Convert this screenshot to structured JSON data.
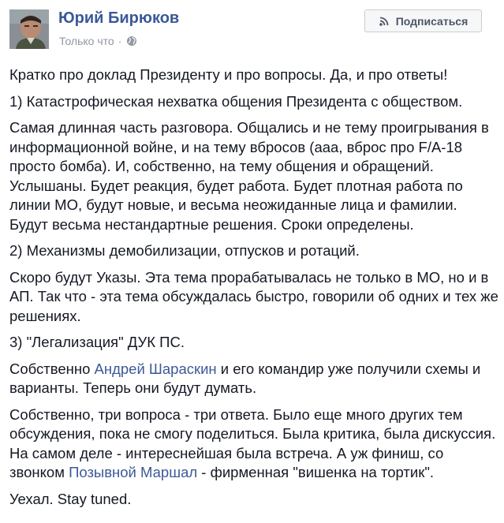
{
  "header": {
    "author": "Юрий Бирюков",
    "time": "Только что",
    "dot": "·",
    "privacy_icon": "globe-icon",
    "subscribe_label": "Подписаться",
    "subscribe_icon": "rss-icon"
  },
  "colors": {
    "link": "#3b5998",
    "text": "#141823",
    "meta": "#9197a3"
  },
  "post": {
    "p1": "Кратко про доклад Президенту и про вопросы. Да, и про ответы!",
    "p2": "1) Катастрофическая нехватка общения Президента с обществом.",
    "p3": "Самая длинная часть разговора. Общались и не тему проигрывания в информационной войне, и на тему вбросов (ааа, вброс про F/A-18 просто бомба). И, собственно, на тему общения и обращений. Услышаны. Будет реакция, будет работа. Будет плотная работа по линии МО, будут новые, и весьма неожиданные лица и фамилии. Будут весьма нестандартные решения. Сроки определены.",
    "p4": "2) Механизмы демобилизации, отпусков и ротаций.",
    "p5": "Скоро будут Указы. Эта тема прорабатывалась не только в МО, но и в АП. Так что - эта тема обсуждалась быстро, говорили об одних и тех же решениях.",
    "p6": "3) \"Легализация\" ДУК ПС.",
    "p7_a": "Собственно ",
    "p7_link": "Андрей Шараскин",
    "p7_b": " и его командир уже получили схемы и варианты. Теперь они будут думать.",
    "p8_a": "Собственно, три вопроса - три ответа. Было еще много других тем обсуждения, пока не смогу поделиться. Была критика, была дискуссия. На самом деле - интереснейшая была встреча. А уж финиш, со звонком ",
    "p8_link": "Позывной Маршал",
    "p8_b": " - фирменная \"вишенка на тортик\".",
    "p9": "Уехал. Stay tuned."
  }
}
